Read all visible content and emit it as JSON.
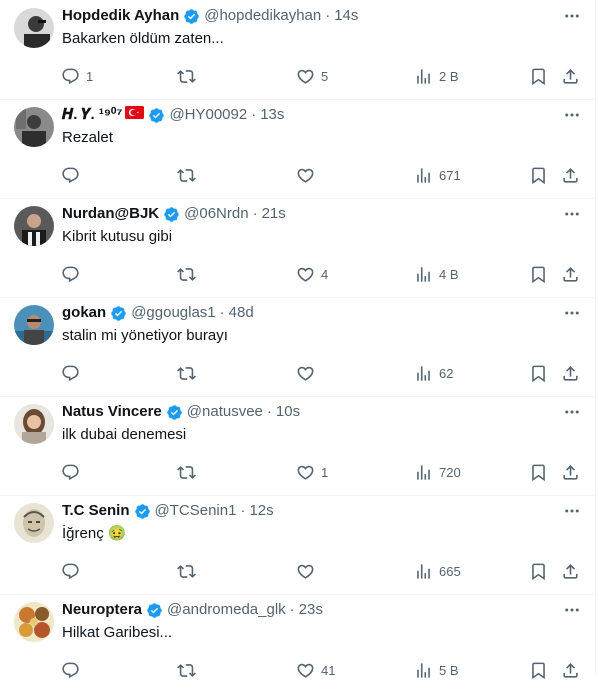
{
  "colors": {
    "verified": "#1d9bf0",
    "icon": "#536471",
    "text": "#0f1419",
    "handle": "#536471",
    "divider": "#eff3f4"
  },
  "icons": {
    "reply": "reply-icon",
    "retweet": "retweet-icon",
    "like": "heart-icon",
    "views": "views-icon",
    "bookmark": "bookmark-icon",
    "share": "share-icon",
    "more": "more-icon"
  },
  "tweets": [
    {
      "name": "Hopdedik Ayhan",
      "handle": "@hopdedikayhan",
      "dot": "·",
      "time": "14s",
      "text": "Bakarken öldüm zaten...",
      "reply": "1",
      "retweet": "",
      "like": "5",
      "views": "2 B"
    },
    {
      "name": "𝑯. 𝒀. ¹⁹⁰⁷",
      "flag": "🇹🇷",
      "handle": "@HY00092",
      "dot": "·",
      "time": "13s",
      "text": "Rezalet",
      "reply": "",
      "retweet": "",
      "like": "",
      "views": "671"
    },
    {
      "name": "Nurdan@BJK",
      "handle": "@06Nrdn",
      "dot": "·",
      "time": "21s",
      "text": "Kibrit kutusu gibi",
      "reply": "",
      "retweet": "",
      "like": "4",
      "views": "4 B"
    },
    {
      "name": "gokan",
      "handle": "@ggouglas1",
      "dot": "·",
      "time": "48d",
      "text": "stalin mi yönetiyor burayı",
      "reply": "",
      "retweet": "",
      "like": "",
      "views": "62"
    },
    {
      "name": "Natus Vincere",
      "handle": "@natusvee",
      "dot": "·",
      "time": "10s",
      "text": "ilk dubai denemesi",
      "reply": "",
      "retweet": "",
      "like": "1",
      "views": "720"
    },
    {
      "name": "T.C Senin",
      "handle": "@TCSenin1",
      "dot": "·",
      "time": "12s",
      "text": "İğrenç 🤢",
      "reply": "",
      "retweet": "",
      "like": "",
      "views": "665"
    },
    {
      "name": "Neuroptera",
      "handle": "@andromeda_glk",
      "dot": "·",
      "time": "23s",
      "text": "Hilkat Garibesi...",
      "reply": "",
      "retweet": "",
      "like": "41",
      "views": "5 B"
    }
  ]
}
